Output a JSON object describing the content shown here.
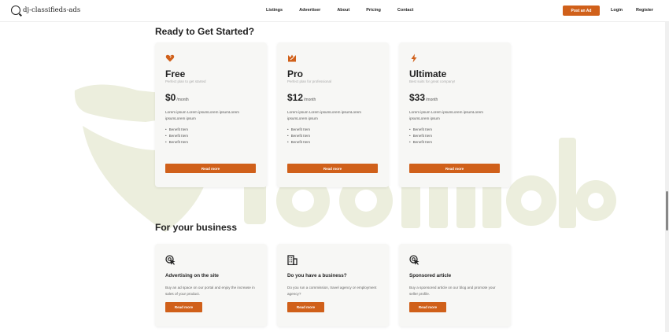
{
  "header": {
    "logo_text": "dj-classifieds-ads",
    "nav": [
      "Listings",
      "Advertiser",
      "About",
      "Pricing",
      "Contact"
    ],
    "post_ad": "Post an Ad",
    "login": "Login",
    "register": "Register"
  },
  "pricing": {
    "title": "Ready to Get Started?",
    "cards": [
      {
        "icon": "heart-icon",
        "title": "Free",
        "subtitle": "Perfect plan to get started",
        "price": "$0",
        "period": "/month",
        "description": "Lorem ipsum Lorem ipsumLorem ipsumLorem ipsumLorem ipsum",
        "benefits": [
          "Benefit Item",
          "Benefit Item",
          "Benefit Item"
        ],
        "button": "Read more"
      },
      {
        "icon": "crown-icon",
        "title": "Pro",
        "subtitle": "Perfect plan for professional",
        "price": "$12",
        "period": "/month",
        "description": "Lorem ipsum Lorem ipsumLorem ipsumLorem ipsumLorem ipsum",
        "benefits": [
          "Benefit Item",
          "Benefit Item",
          "Benefit Item"
        ],
        "button": "Read more"
      },
      {
        "icon": "lightning-icon",
        "title": "Ultimate",
        "subtitle": "Best suits for great company!",
        "price": "$33",
        "period": "/month",
        "description": "Lorem ipsum Lorem ipsumLorem ipsumLorem ipsumLorem ipsum",
        "benefits": [
          "Benefit Item",
          "Benefit Item",
          "Benefit Item"
        ],
        "button": "Read more"
      }
    ]
  },
  "business": {
    "title": "For your business",
    "cards": [
      {
        "icon": "cursor-click-icon",
        "title": "Advertising on the site",
        "description": "Buy an ad space on our portal and enjoy the increase in sales of your product.",
        "button": "Read more"
      },
      {
        "icon": "building-icon",
        "title": "Do you have a business?",
        "description": "Do you run a commission, travel agency or employment agency?",
        "button": "Read more"
      },
      {
        "icon": "cursor-click-icon",
        "title": "Sponsored article",
        "description": "Buy a sponsored article on our blog and promote your seller profile.",
        "button": "Read more"
      }
    ]
  },
  "colors": {
    "accent": "#d0601a",
    "card_bg": "#f7f7f5",
    "watermark": "#e9ecd8"
  }
}
